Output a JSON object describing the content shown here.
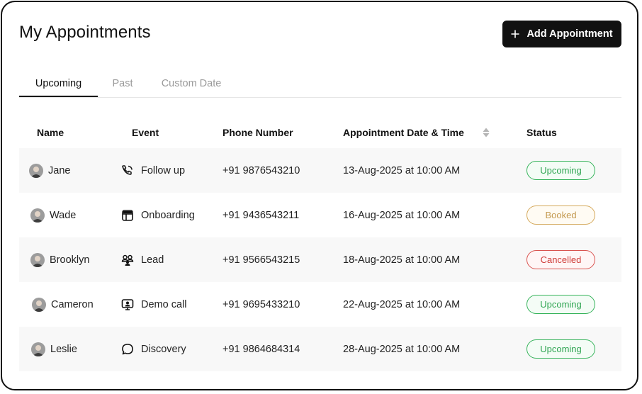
{
  "header": {
    "title": "My Appointments",
    "add_button_label": "Add Appointment"
  },
  "tabs": [
    {
      "label": "Upcoming",
      "active": true
    },
    {
      "label": "Past",
      "active": false
    },
    {
      "label": "Custom Date",
      "active": false
    }
  ],
  "table": {
    "columns": [
      "Name",
      "Event",
      "Phone Number",
      "Appointment Date & Time",
      "Status"
    ],
    "rows": [
      {
        "name": "Jane",
        "event": "Follow up",
        "event_icon": "follow-up-icon",
        "phone": "+91 9876543210",
        "datetime": "13-Aug-2025 at 10:00 AM",
        "status": "Upcoming"
      },
      {
        "name": "Wade",
        "event": "Onboarding",
        "event_icon": "onboarding-icon",
        "phone": "+91 9436543211",
        "datetime": "16-Aug-2025 at 10:00 AM",
        "status": "Booked"
      },
      {
        "name": "Brooklyn",
        "event": "Lead",
        "event_icon": "lead-icon",
        "phone": "+91 9566543215",
        "datetime": "18-Aug-2025 at 10:00 AM",
        "status": "Cancelled"
      },
      {
        "name": "Cameron",
        "event": "Demo call",
        "event_icon": "demo-call-icon",
        "phone": "+91 9695433210",
        "datetime": "22-Aug-2025 at 10:00 AM",
        "status": "Upcoming"
      },
      {
        "name": "Leslie",
        "event": "Discovery",
        "event_icon": "discovery-icon",
        "phone": "+91 9864684314",
        "datetime": "28-Aug-2025 at 10:00 AM",
        "status": "Upcoming"
      }
    ]
  },
  "colors": {
    "primary": "#111111",
    "upcoming": "#2fa552",
    "booked": "#c49a50",
    "cancelled": "#cf3b37",
    "row_shade": "#f8f8f8"
  }
}
